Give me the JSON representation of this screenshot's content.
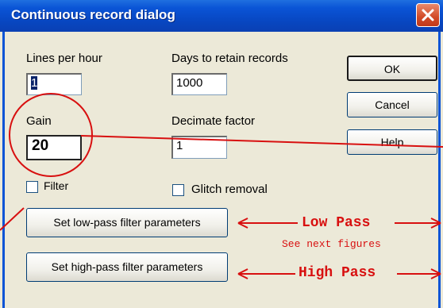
{
  "window": {
    "title": "Continuous record dialog",
    "close_icon": "close-icon"
  },
  "fields": {
    "lines_per_hour": {
      "label": "Lines per hour",
      "value": "1"
    },
    "days_to_retain": {
      "label": "Days to retain records",
      "value": "1000"
    },
    "gain": {
      "label": "Gain",
      "value": "20"
    },
    "decimate": {
      "label": "Decimate factor",
      "value": "1"
    }
  },
  "checkboxes": {
    "filter": {
      "label": "Filter",
      "checked": false
    },
    "glitch": {
      "label": "Glitch removal",
      "checked": false
    }
  },
  "buttons": {
    "ok": "OK",
    "cancel": "Cancel",
    "help": "Help",
    "low_pass": "Set low-pass filter parameters",
    "high_pass": "Set high-pass filter parameters"
  },
  "annotations": {
    "low_pass": "Low Pass",
    "see_next": "See next figures",
    "high_pass": "High Pass",
    "color": "#d81010"
  },
  "colors": {
    "titlebar": "#0a54d6",
    "dialog_bg": "#ece9d8",
    "close_button": "#d24a26"
  }
}
